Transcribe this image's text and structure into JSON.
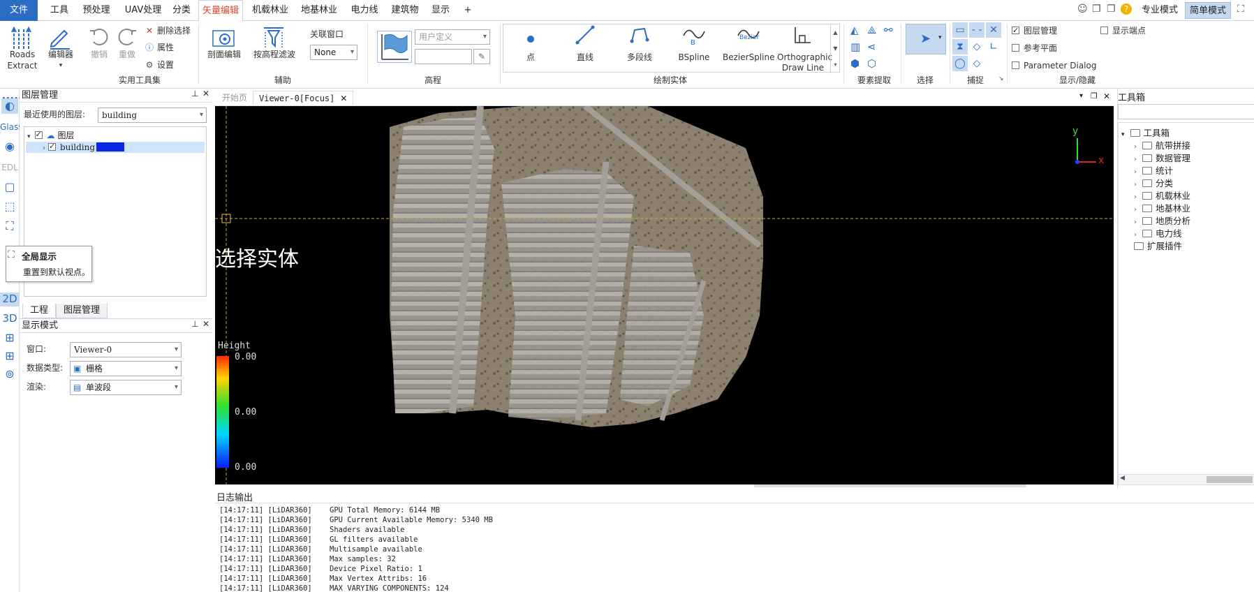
{
  "menubar": {
    "file": "文件",
    "items": [
      "工具",
      "预处理",
      "UAV处理",
      "分类",
      "矢量编辑",
      "机载林业",
      "地基林业",
      "电力线",
      "建筑物",
      "显示",
      "+"
    ],
    "active_index": 4,
    "mode_pro": "专业模式",
    "mode_simple": "简单模式"
  },
  "ribbon": {
    "roads": {
      "line1": "Roads",
      "line2": "Extract"
    },
    "editor": "编辑器",
    "undo": "撤销",
    "redo": "重做",
    "delete_selection": "删除选择",
    "properties": "属性",
    "settings": "设置",
    "group_tools": "实用工具集",
    "profile_edit": "剖面编辑",
    "elevation_filter": "按高程滤波",
    "link_window": "关联窗口",
    "link_none": "None",
    "group_aux": "辅助",
    "elevation_combo": "用户定义",
    "group_elevation": "高程",
    "draw_items": [
      "点",
      "直线",
      "多段线",
      "BSpline",
      "BezierSpline",
      "Orthographic"
    ],
    "draw_line2": "Draw Line",
    "bezier_caption": "Bezier",
    "group_draw": "绘制实体",
    "group_extract": "要素提取",
    "group_select": "选择",
    "group_snap": "捕捉",
    "chk_layer_mgmt": "图层管理",
    "chk_ref_plane": "参考平面",
    "chk_param_dialog": "Parameter Dialog",
    "chk_show_vertex": "显示端点",
    "group_showhide": "显示/隐藏"
  },
  "leftstrip": {
    "glass": "Glass",
    "edl": "EDL",
    "mode2d": "2D",
    "mode3d": "3D"
  },
  "layer_panel": {
    "title": "图层管理",
    "recent_label": "最近使用的图层:",
    "recent_value": "building",
    "root": "图层",
    "child": "building",
    "tab_project": "工程",
    "tab_layer": "图层管理"
  },
  "tooltip": {
    "title": "全局显示",
    "desc": "重置到默认视点。"
  },
  "display_panel": {
    "title": "显示模式",
    "window_label": "窗口:",
    "window_value": "Viewer-0",
    "datatype_label": "数据类型:",
    "datatype_value": "栅格",
    "render_label": "渲染:",
    "render_value": "单波段"
  },
  "viewer": {
    "tab_start": "开始页",
    "tab_viewer": "Viewer-0[Focus]",
    "overlay_text": "选择实体",
    "legend_title": "Height",
    "legend_values": [
      "0.00",
      "0.00",
      "0.00"
    ],
    "axis_y": "y",
    "axis_x": "x"
  },
  "log": {
    "title": "日志输出",
    "lines": [
      "[14:17:11] [LiDAR360]    GPU Total Memory: 6144 MB",
      "[14:17:11] [LiDAR360]    GPU Current Available Memory: 5340 MB",
      "[14:17:11] [LiDAR360]    Shaders available",
      "[14:17:11] [LiDAR360]    GL filters available",
      "[14:17:11] [LiDAR360]    Multisample available",
      "[14:17:11] [LiDAR360]    Max samples: 32",
      "[14:17:11] [LiDAR360]    Device Pixel Ratio: 1",
      "[14:17:11] [LiDAR360]    Max Vertex Attribs: 16",
      "[14:17:11] [LiDAR360]    MAX VARYING COMPONENTS: 124"
    ]
  },
  "toolbox": {
    "title": "工具箱",
    "root": "工具箱",
    "items": [
      "航带拼接",
      "数据管理",
      "统计",
      "分类",
      "机载林业",
      "地基林业",
      "地质分析",
      "电力线"
    ],
    "ext": "扩展插件"
  }
}
